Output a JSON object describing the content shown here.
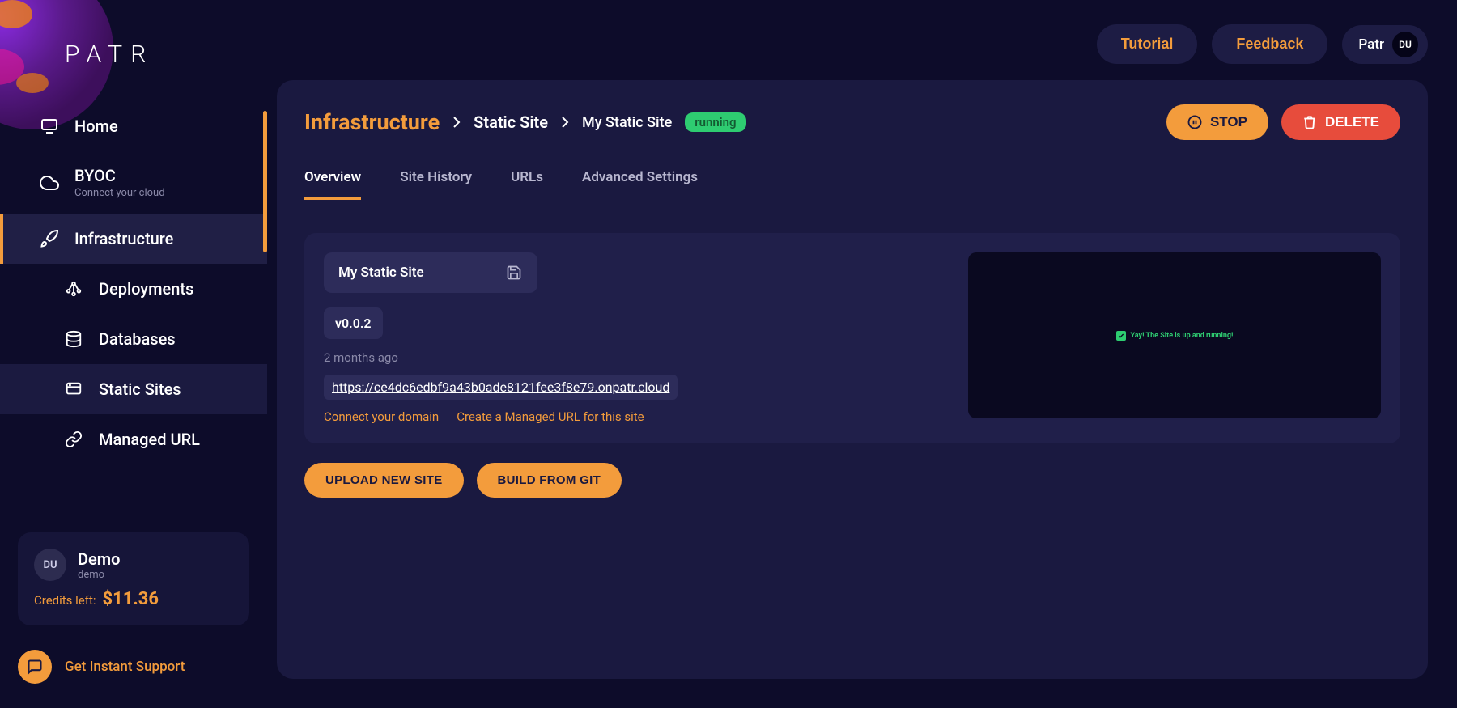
{
  "brand": {
    "name": "PATR"
  },
  "topbar": {
    "tutorial": "Tutorial",
    "feedback": "Feedback",
    "workspace": "Patr",
    "avatar": "DU"
  },
  "sidebar": {
    "items": [
      {
        "label": "Home",
        "sub": ""
      },
      {
        "label": "BYOC",
        "sub": "Connect your cloud"
      },
      {
        "label": "Infrastructure",
        "sub": ""
      },
      {
        "label": "Deployments",
        "sub": ""
      },
      {
        "label": "Databases",
        "sub": ""
      },
      {
        "label": "Static Sites",
        "sub": ""
      },
      {
        "label": "Managed URL",
        "sub": ""
      }
    ],
    "account": {
      "avatar": "DU",
      "name": "Demo",
      "sub": "demo",
      "credits_label": "Credits left:",
      "credits_value": "$11.36"
    },
    "support": "Get Instant Support"
  },
  "breadcrumb": {
    "root": "Infrastructure",
    "mid": "Static Site",
    "leaf": "My Static Site",
    "status": "running"
  },
  "header_actions": {
    "stop": "STOP",
    "delete": "DELETE"
  },
  "tabs": [
    "Overview",
    "Site History",
    "URLs",
    "Advanced Settings"
  ],
  "overview": {
    "site_name": "My Static Site",
    "version": "v0.0.2",
    "timestamp": "2 months ago",
    "url": "https://ce4dc6edbf9a43b0ade8121fee3f8e79.onpatr.cloud",
    "connect_domain": "Connect your domain",
    "managed_url": "Create a Managed URL for this site",
    "preview_msg": "Yay! The Site is up and running!"
  },
  "actions": {
    "upload": "UPLOAD NEW SITE",
    "build": "BUILD FROM GIT"
  }
}
